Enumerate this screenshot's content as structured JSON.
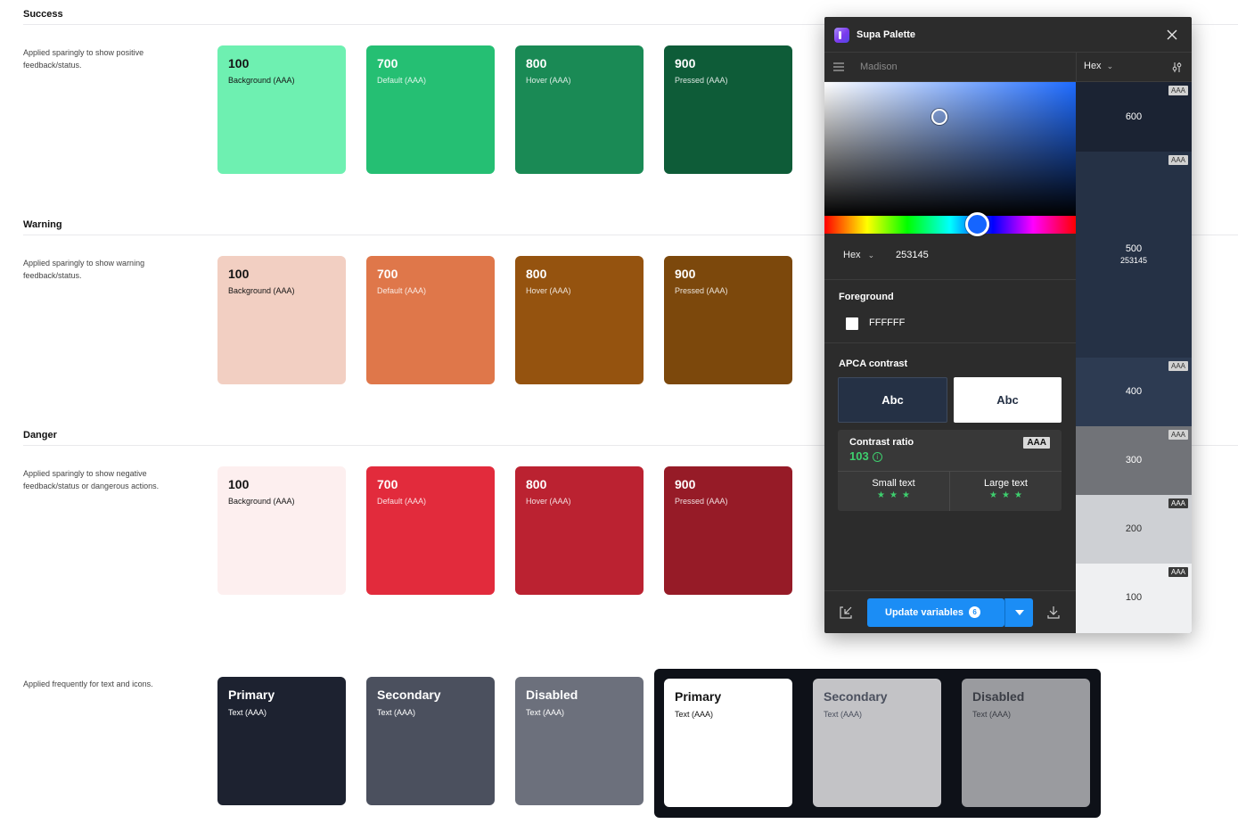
{
  "sections": {
    "success": {
      "title": "Success",
      "description": "Applied sparingly to show positive feedback/status.",
      "swatches": [
        {
          "num": "100",
          "role": "Background (AAA)",
          "color": "#6ef0b1"
        },
        {
          "num": "700",
          "role": "Default (AAA)",
          "color": "#25bf73"
        },
        {
          "num": "800",
          "role": "Hover (AAA)",
          "color": "#1a8a55"
        },
        {
          "num": "900",
          "role": "Pressed (AAA)",
          "color": "#0e5c38"
        }
      ]
    },
    "warning": {
      "title": "Warning",
      "description": "Applied sparingly to show warning feedback/status.",
      "swatches": [
        {
          "num": "100",
          "role": "Background (AAA)",
          "color": "#f2cfc2"
        },
        {
          "num": "700",
          "role": "Default (AAA)",
          "color": "#df774a"
        },
        {
          "num": "800",
          "role": "Hover (AAA)",
          "color": "#95530f"
        },
        {
          "num": "900",
          "role": "Pressed (AAA)",
          "color": "#7c480c"
        }
      ]
    },
    "danger": {
      "title": "Danger",
      "description": "Applied sparingly to show negative feedback/status or dangerous actions.",
      "swatches": [
        {
          "num": "100",
          "role": "Background (AAA)",
          "color": "#fdefef"
        },
        {
          "num": "700",
          "role": "Default (AAA)",
          "color": "#e22b3c"
        },
        {
          "num": "800",
          "role": "Hover (AAA)",
          "color": "#bb2231"
        },
        {
          "num": "900",
          "role": "Pressed (AAA)",
          "color": "#961b27"
        }
      ]
    },
    "text": {
      "description": "Applied frequently for text and icons.",
      "light_swatches": [
        {
          "num": "Primary",
          "role": "Text (AAA)",
          "color": "#1d2230"
        },
        {
          "num": "Secondary",
          "role": "Text (AAA)",
          "color": "#4b505e"
        },
        {
          "num": "Disabled",
          "role": "Text (AAA)",
          "color": "#6c707c"
        }
      ],
      "dark_swatches": [
        {
          "num": "Primary",
          "role": "Text (AAA)",
          "color": "#ffffff"
        },
        {
          "num": "Secondary",
          "role": "Text (AAA)",
          "color": "#c3c3c6"
        },
        {
          "num": "Disabled",
          "role": "Text (AAA)",
          "color": "#9a9b9f"
        }
      ]
    }
  },
  "plugin": {
    "title": "Supa Palette",
    "palette_name": "Madison",
    "format": "Hex",
    "color_mode": "Hex",
    "color_value": "253145",
    "foreground_label": "Foreground",
    "foreground_value": "FFFFFF",
    "apca_label": "APCA contrast",
    "abc_dark": "Abc",
    "abc_light": "Abc",
    "contrast_label": "Contrast ratio",
    "contrast_value": "103",
    "contrast_badge": "AAA",
    "small_text": "Small text",
    "large_text": "Large text",
    "small_stars": "★★★",
    "large_stars": "★★★",
    "update_label": "Update variables",
    "update_count": "6",
    "scale": [
      {
        "label": "600",
        "hex": "",
        "tag": "AAA",
        "bg": "#1b2333",
        "fg": "#ffffff"
      },
      {
        "label": "500",
        "hex": "253145",
        "tag": "AAA",
        "bg": "#253145",
        "fg": "#ffffff"
      },
      {
        "label": "400",
        "hex": "",
        "tag": "AAA",
        "bg": "#2d3b52",
        "fg": "#ffffff"
      },
      {
        "label": "300",
        "hex": "",
        "tag": "AAA",
        "bg": "#717378",
        "fg": "#ffffff"
      },
      {
        "label": "200",
        "hex": "",
        "tag": "AAA",
        "bg": "#ced0d4",
        "fg": "#333333"
      },
      {
        "label": "100",
        "hex": "",
        "tag": "AAA",
        "bg": "#eff0f2",
        "fg": "#333333"
      }
    ]
  }
}
